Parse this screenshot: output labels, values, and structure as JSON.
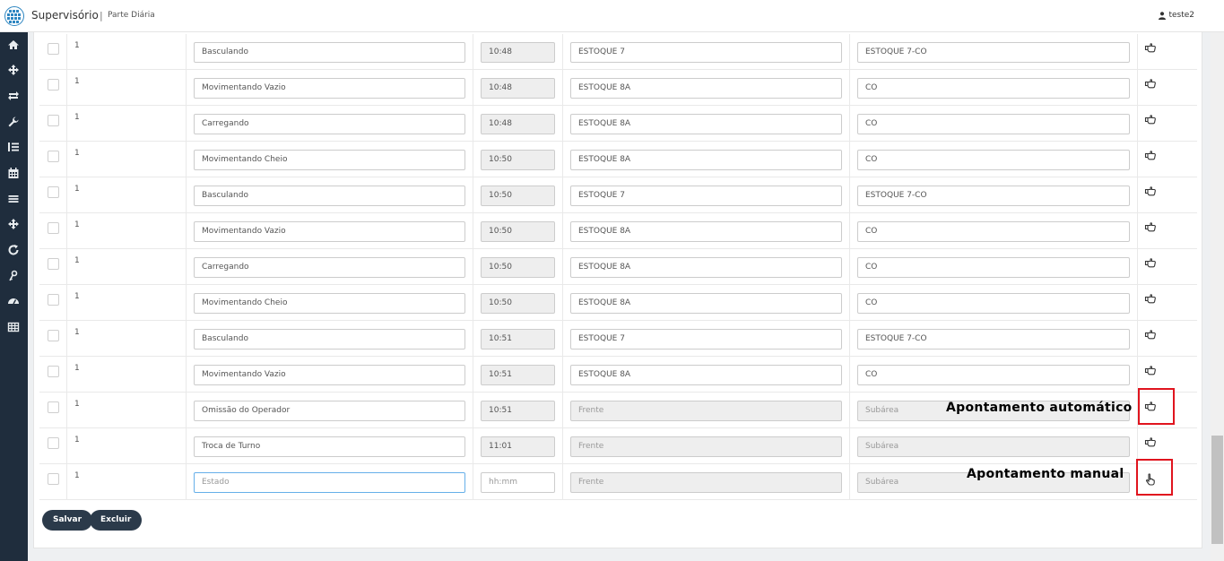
{
  "header": {
    "app_title": "Supervisório",
    "separator": "|",
    "page_subtitle": "Parte Diária",
    "user_name": "teste2"
  },
  "sidebar": {
    "icons": [
      "home-icon",
      "move-icon",
      "exchange-icon",
      "wrench-icon",
      "list-ol-icon",
      "calendar-icon",
      "menu-icon",
      "move-icon",
      "refresh-icon",
      "key-icon",
      "dashboard-icon",
      "table-icon"
    ]
  },
  "table": {
    "placeholders": {
      "state": "Estado",
      "time": "hh:mm",
      "front": "Frente",
      "subarea": "Subárea"
    },
    "rows": [
      {
        "num": "1",
        "state": "Basculando",
        "time": "10:48",
        "front": "ESTOQUE 7",
        "subarea": "ESTOQUE 7-CO",
        "mode": "auto"
      },
      {
        "num": "1",
        "state": "Movimentando Vazio",
        "time": "10:48",
        "front": "ESTOQUE 8A",
        "subarea": "CO",
        "mode": "auto"
      },
      {
        "num": "1",
        "state": "Carregando",
        "time": "10:48",
        "front": "ESTOQUE 8A",
        "subarea": "CO",
        "mode": "auto"
      },
      {
        "num": "1",
        "state": "Movimentando Cheio",
        "time": "10:50",
        "front": "ESTOQUE 8A",
        "subarea": "CO",
        "mode": "auto"
      },
      {
        "num": "1",
        "state": "Basculando",
        "time": "10:50",
        "front": "ESTOQUE 7",
        "subarea": "ESTOQUE 7-CO",
        "mode": "auto"
      },
      {
        "num": "1",
        "state": "Movimentando Vazio",
        "time": "10:50",
        "front": "ESTOQUE 8A",
        "subarea": "CO",
        "mode": "auto"
      },
      {
        "num": "1",
        "state": "Carregando",
        "time": "10:50",
        "front": "ESTOQUE 8A",
        "subarea": "CO",
        "mode": "auto"
      },
      {
        "num": "1",
        "state": "Movimentando Cheio",
        "time": "10:50",
        "front": "ESTOQUE 8A",
        "subarea": "CO",
        "mode": "auto"
      },
      {
        "num": "1",
        "state": "Basculando",
        "time": "10:51",
        "front": "ESTOQUE 7",
        "subarea": "ESTOQUE 7-CO",
        "mode": "auto"
      },
      {
        "num": "1",
        "state": "Movimentando Vazio",
        "time": "10:51",
        "front": "ESTOQUE 8A",
        "subarea": "CO",
        "mode": "auto"
      },
      {
        "num": "1",
        "state": "Omissão do Operador",
        "time": "10:51",
        "front": "",
        "subarea": "",
        "mode": "auto"
      },
      {
        "num": "1",
        "state": "Troca de Turno",
        "time": "11:01",
        "front": "",
        "subarea": "",
        "mode": "auto"
      },
      {
        "num": "1",
        "state": "",
        "time": "",
        "front": "",
        "subarea": "",
        "mode": "manual"
      }
    ]
  },
  "buttons": {
    "save": "Salvar",
    "delete": "Excluir"
  },
  "annotations": {
    "auto": "Apontamento automático",
    "manual": "Apontamento manual",
    "box_color": "#e0141e"
  },
  "colors": {
    "sidebar": "#1f2d3d",
    "button": "#2b3a4a"
  }
}
